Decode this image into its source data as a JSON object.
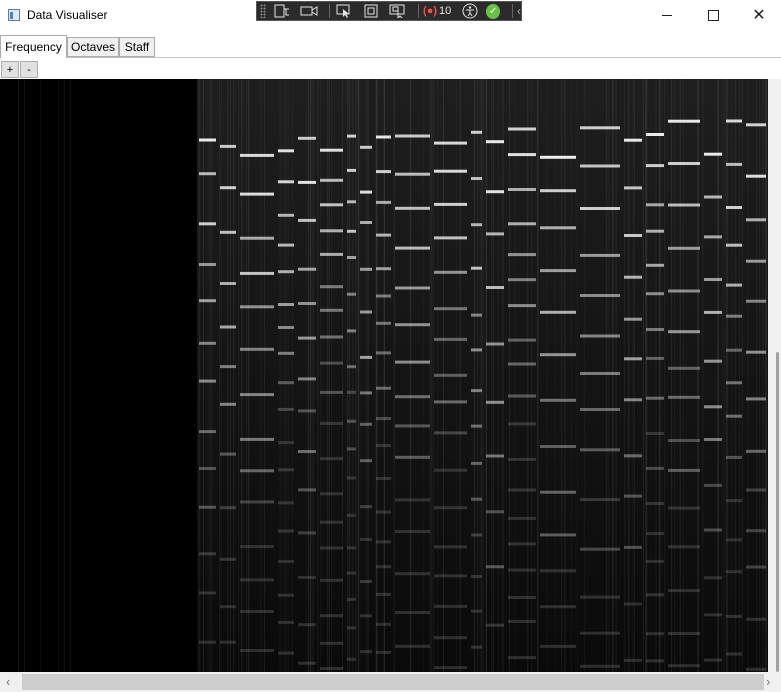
{
  "window": {
    "title": "Data Visualiser",
    "icon": "app-window-icon",
    "controls": {
      "minimize": "minimize-icon",
      "maximize": "maximize-icon",
      "close": "close-icon"
    }
  },
  "debug_toolbar": {
    "items": [
      "live-visual-tree-icon",
      "video-camera-icon",
      "select-element-icon",
      "display-layout-adorners-icon",
      "track-focused-element-icon"
    ],
    "binding_failures_count": "10",
    "status": "no-issues-check-icon",
    "colors": {
      "background": "#2b2b2b",
      "error": "#f05050",
      "ok": "#6cc04a"
    }
  },
  "tabs": [
    {
      "label": "Frequency",
      "selected": true
    },
    {
      "label": "Octaves",
      "selected": false
    },
    {
      "label": "Staff",
      "selected": false
    }
  ],
  "zoom": {
    "plus": "+",
    "minus": "-"
  },
  "spectrogram": {
    "background": "#000000",
    "foreground": "#ffffff"
  }
}
